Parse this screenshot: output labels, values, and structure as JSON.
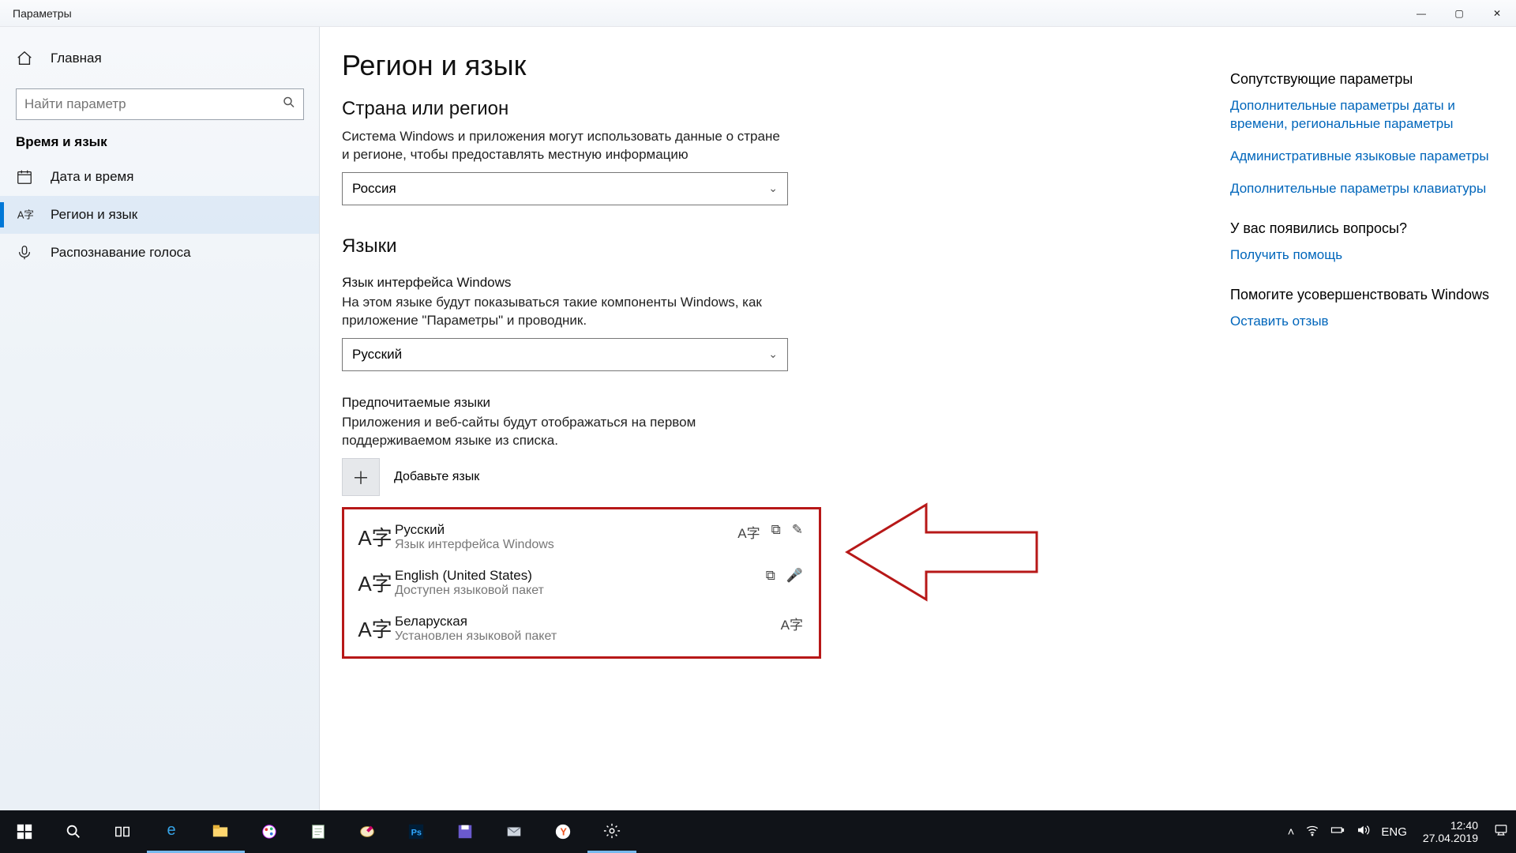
{
  "window": {
    "title": "Параметры"
  },
  "sidebar": {
    "home": "Главная",
    "search_placeholder": "Найти параметр",
    "section": "Время и язык",
    "items": [
      {
        "label": "Дата и время"
      },
      {
        "label": "Регион и язык"
      },
      {
        "label": "Распознавание голоса"
      }
    ]
  },
  "main": {
    "title": "Регион и язык",
    "region_heading": "Страна или регион",
    "region_desc": "Система Windows и приложения могут использовать данные о стране и регионе, чтобы предоставлять местную информацию",
    "region_selected": "Россия",
    "languages_heading": "Языки",
    "display_lang_label": "Язык интерфейса Windows",
    "display_lang_desc": "На этом языке будут показываться такие компоненты Windows, как приложение \"Параметры\" и проводник.",
    "display_lang_selected": "Русский",
    "preferred_label": "Предпочитаемые языки",
    "preferred_desc": "Приложения и веб-сайты будут отображаться на первом поддерживаемом языке из списка.",
    "add_label": "Добавьте язык",
    "langs": [
      {
        "name": "Русский",
        "sub": "Язык интерфейса Windows",
        "caps": [
          "A字",
          "⧉",
          "✎"
        ]
      },
      {
        "name": "English (United States)",
        "sub": "Доступен языковой пакет",
        "caps": [
          "⧉",
          "🎤"
        ]
      },
      {
        "name": "Беларуская",
        "sub": "Установлен языковой пакет",
        "caps": [
          "A字"
        ]
      }
    ]
  },
  "related": {
    "heading": "Сопутствующие параметры",
    "links": [
      "Дополнительные параметры даты и времени, региональные параметры",
      "Административные языковые параметры",
      "Дополнительные параметры клавиатуры"
    ],
    "help_heading": "У вас появились вопросы?",
    "help_link": "Получить помощь",
    "feedback_heading": "Помогите усовершенствовать Windows",
    "feedback_link": "Оставить отзыв"
  },
  "taskbar": {
    "lang": "ENG",
    "time": "12:40",
    "date": "27.04.2019"
  }
}
